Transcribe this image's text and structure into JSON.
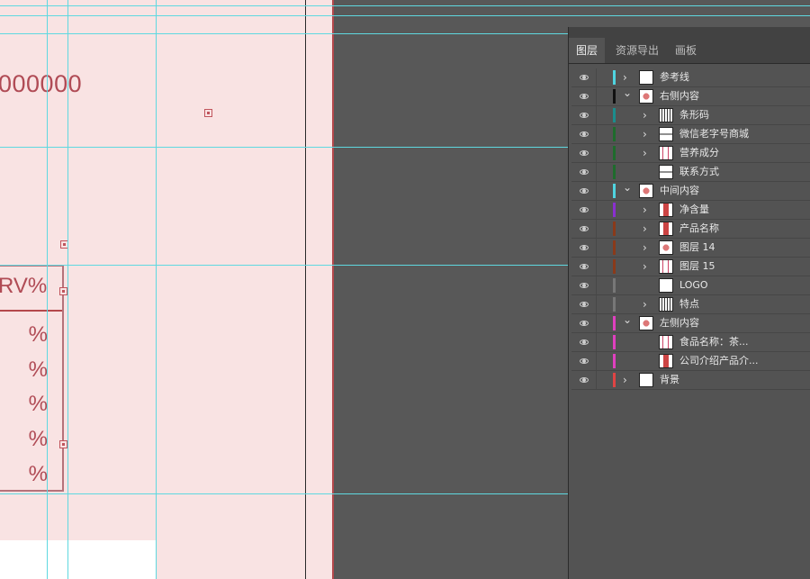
{
  "canvas": {
    "big_number": "000000",
    "nrv_header": "RV%",
    "percent_cells": [
      "%",
      "%",
      "%",
      "%",
      "%"
    ]
  },
  "panel": {
    "tabs": [
      {
        "label": "图层",
        "active": true
      },
      {
        "label": "资源导出",
        "active": false
      },
      {
        "label": "画板",
        "active": false
      }
    ],
    "layers": [
      {
        "name": "参考线",
        "level": 0,
        "expand": "collapsed",
        "tag": "#4fd4e0",
        "thumb": "blank"
      },
      {
        "name": "右侧内容",
        "level": 0,
        "expand": "expanded",
        "tag": "#111111",
        "thumb": "pattern-c"
      },
      {
        "name": "条形码",
        "level": 1,
        "expand": "collapsed",
        "tag": "#1b8d8d",
        "thumb": "pattern-d"
      },
      {
        "name": "微信老字号商城",
        "level": 1,
        "expand": "collapsed",
        "tag": "#1e6b2c",
        "thumb": "pattern-b"
      },
      {
        "name": "营养成分",
        "level": 1,
        "expand": "collapsed",
        "tag": "#1e6b2c",
        "thumb": "pattern-a"
      },
      {
        "name": "联系方式",
        "level": 1,
        "expand": "none",
        "tag": "#1e6b2c",
        "thumb": "pattern-b"
      },
      {
        "name": "中间内容",
        "level": 0,
        "expand": "expanded",
        "tag": "#4fd4e0",
        "thumb": "pattern-c"
      },
      {
        "name": "净含量",
        "level": 1,
        "expand": "collapsed",
        "tag": "#8a2fd0",
        "thumb": "pattern-e"
      },
      {
        "name": "产品名称",
        "level": 1,
        "expand": "collapsed",
        "tag": "#8a3a1a",
        "thumb": "pattern-e"
      },
      {
        "name": "图层 14",
        "level": 1,
        "expand": "collapsed",
        "tag": "#8a3a1a",
        "thumb": "pattern-c"
      },
      {
        "name": "图层 15",
        "level": 1,
        "expand": "collapsed",
        "tag": "#8a3a1a",
        "thumb": "pattern-a"
      },
      {
        "name": "LOGO",
        "level": 1,
        "expand": "none",
        "tag": "#777777",
        "thumb": "blank"
      },
      {
        "name": "特点",
        "level": 1,
        "expand": "collapsed",
        "tag": "#777777",
        "thumb": "pattern-d"
      },
      {
        "name": "左侧内容",
        "level": 0,
        "expand": "expanded",
        "tag": "#e040c0",
        "thumb": "pattern-c"
      },
      {
        "name": "食品名称：茶...",
        "level": 1,
        "expand": "none",
        "tag": "#e040c0",
        "thumb": "pattern-a"
      },
      {
        "name": "公司介绍产品介...",
        "level": 1,
        "expand": "none",
        "tag": "#e040c0",
        "thumb": "pattern-e"
      },
      {
        "name": "背景",
        "level": 0,
        "expand": "collapsed",
        "tag": "#e04444",
        "thumb": "blank"
      }
    ]
  }
}
